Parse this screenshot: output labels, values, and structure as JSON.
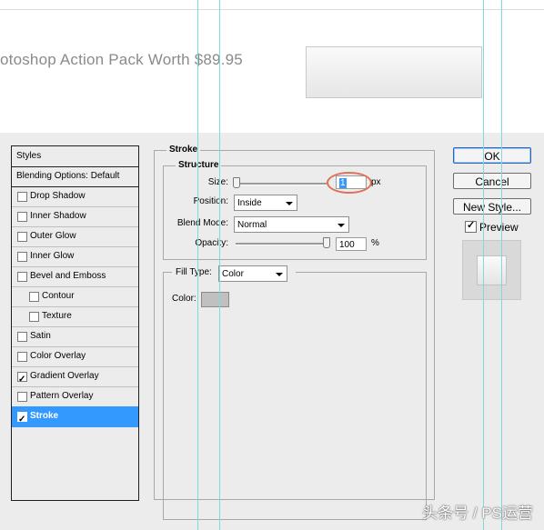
{
  "background": {
    "banner_text": "otoshop Action Pack Worth $89.95"
  },
  "layer_style": {
    "styles_header": "Styles",
    "list": [
      {
        "label": "Blending Options: Default",
        "checkbox": false,
        "checked": false,
        "selected": false
      },
      {
        "label": "Drop Shadow",
        "checkbox": true,
        "checked": false,
        "selected": false
      },
      {
        "label": "Inner Shadow",
        "checkbox": true,
        "checked": false,
        "selected": false
      },
      {
        "label": "Outer Glow",
        "checkbox": true,
        "checked": false,
        "selected": false
      },
      {
        "label": "Inner Glow",
        "checkbox": true,
        "checked": false,
        "selected": false
      },
      {
        "label": "Bevel and Emboss",
        "checkbox": true,
        "checked": false,
        "selected": false
      },
      {
        "label": "Contour",
        "checkbox": true,
        "checked": false,
        "selected": false
      },
      {
        "label": "Texture",
        "checkbox": true,
        "checked": false,
        "selected": false
      },
      {
        "label": "Satin",
        "checkbox": true,
        "checked": false,
        "selected": false
      },
      {
        "label": "Color Overlay",
        "checkbox": true,
        "checked": false,
        "selected": false
      },
      {
        "label": "Gradient Overlay",
        "checkbox": true,
        "checked": true,
        "selected": false
      },
      {
        "label": "Pattern Overlay",
        "checkbox": true,
        "checked": false,
        "selected": false
      },
      {
        "label": "Stroke",
        "checkbox": true,
        "checked": true,
        "selected": true
      }
    ],
    "stroke": {
      "title": "Stroke",
      "structure_title": "Structure",
      "size_label": "Size:",
      "size_value": "1",
      "size_unit": "px",
      "position_label": "Position:",
      "position_value": "Inside",
      "blend_label": "Blend Mode:",
      "blend_value": "Normal",
      "opacity_label": "Opacity:",
      "opacity_value": "100",
      "opacity_unit": "%",
      "fill_type_label": "Fill Type:",
      "fill_type_value": "Color",
      "color_label": "Color:",
      "stroke_color": "#c0c0c0"
    },
    "buttons": {
      "ok": "OK",
      "cancel": "Cancel",
      "new_style": "New Style...",
      "preview_label": "Preview"
    }
  },
  "watermark": "头条号 / PS运营",
  "colors": {
    "selection": "#3399ff",
    "guide": "#7fd9de",
    "highlight_circle": "#e0705a"
  }
}
